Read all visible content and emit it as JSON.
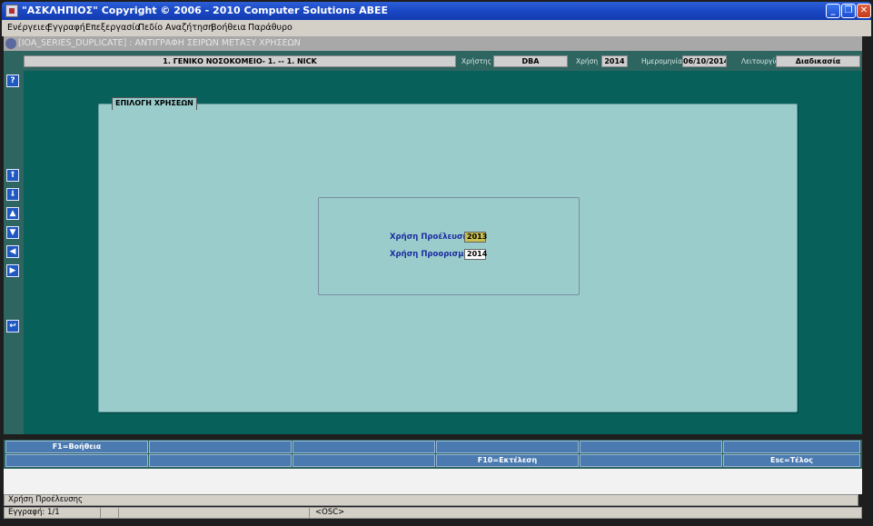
{
  "window": {
    "title": "\"ΑΣΚΛΗΠΙΟΣ\" Copyright © 2006 - 2010 Computer Solutions ΑΒΕΕ",
    "minimize": "_",
    "maximize": "❐",
    "close": "✕"
  },
  "menu": [
    "Ενέργειες",
    "Εγγραφή",
    "Επεξεργασία",
    "Πεδίο",
    "Αναζήτηση",
    "Βοήθεια",
    "Παράθυρο"
  ],
  "form_title": "[IOA_SERIES_DUPLICATE]   :  ΑΝΤΙΓΡΑΦΗ ΣΕΙΡΩΝ ΜΕΤΑΞΥ ΧΡΗΣΕΩΝ",
  "header": {
    "hospital": "1. ΓΕΝΙΚΟ ΝΟΣΟΚΟΜΕΙΟ- 1. -- 1. NICK",
    "user_label": "Χρήστης",
    "user_value": "DBA",
    "year_label": "Χρήση",
    "year_value": "2014",
    "date_label": "Ημερομηνία",
    "date_value": "06/10/2014",
    "function_label": "Λειτουργία",
    "function_value": "Διαδικασία"
  },
  "left_toolbar": {
    "help": "?",
    "first": "⇑",
    "last": "⇓",
    "prev": "▲",
    "next": "▼",
    "left": "◀",
    "right": "▶",
    "back": "↩"
  },
  "panel": {
    "tab_title": "ΕΠΙΛΟΓΗ ΧΡΗΣΕΩΝ",
    "origin_label": "Χρήση Προέλευσης",
    "origin_value": "2013",
    "dest_label": "Χρήση Προορισμού",
    "dest_value": "2014"
  },
  "function_keys": {
    "row1": [
      "F1=Βοήθεια",
      "",
      "",
      "",
      "",
      ""
    ],
    "row2": [
      "",
      "",
      "",
      "F10=Εκτέλεση",
      "",
      "Esc=Τέλος"
    ]
  },
  "status": {
    "hint": "Χρήση Προέλευσης",
    "record": "Εγγραφή: 1/1",
    "mode": "<OSC>"
  },
  "colors": {
    "title_bar": "#1a48c4",
    "main_bg": "#07605a",
    "panel_bg": "#9acccc",
    "label_blue": "#1c2ca0",
    "origin_field": "#c8c050"
  }
}
